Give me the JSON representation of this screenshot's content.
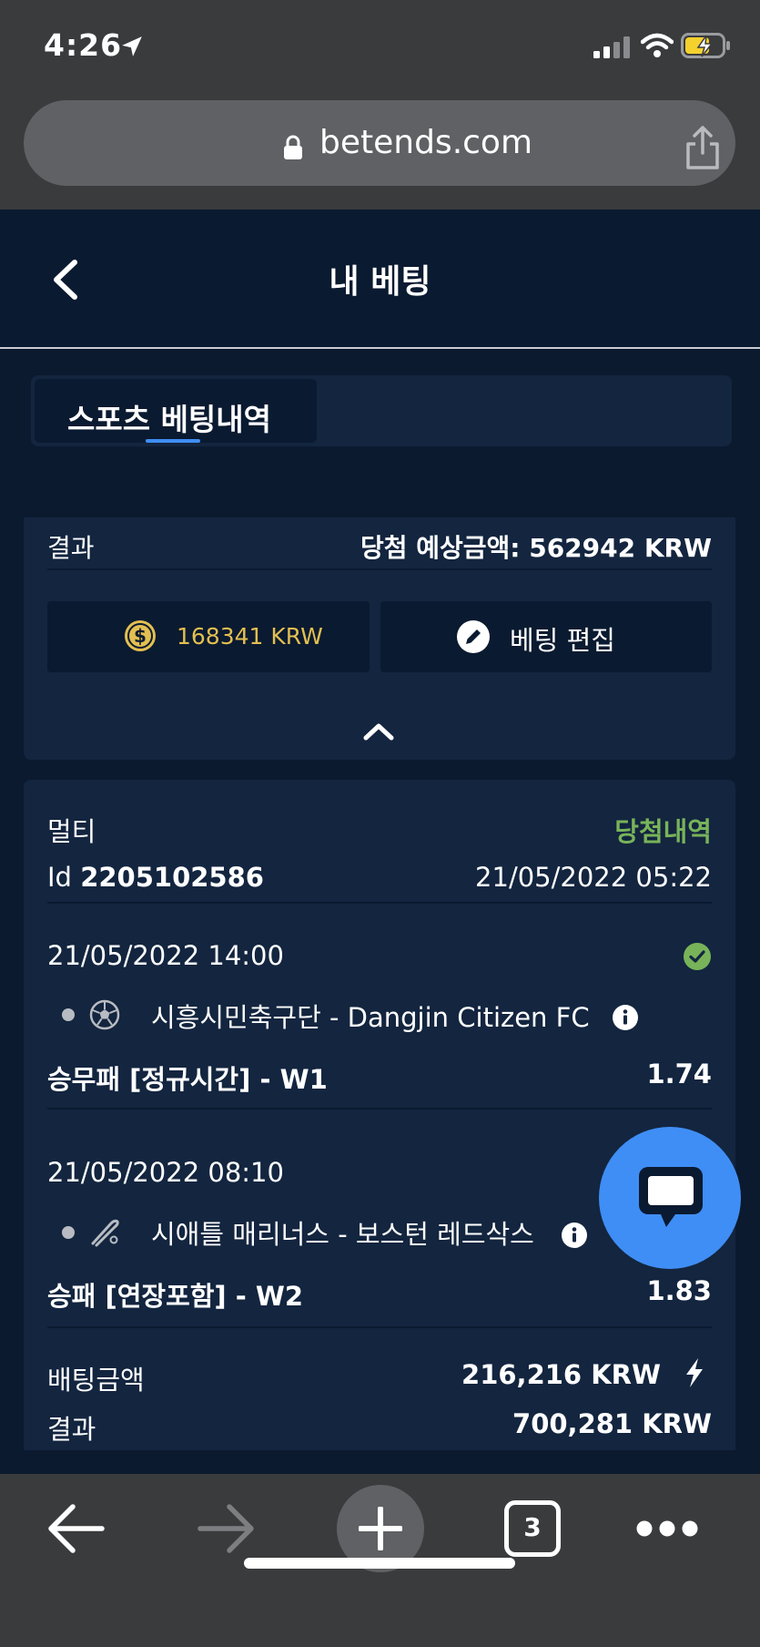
{
  "status_bar": {
    "time": "4:26"
  },
  "browser": {
    "url": "betends.com",
    "open_tabs": "3"
  },
  "header": {
    "title": "내 베팅"
  },
  "tabs": [
    {
      "label": "스포츠 베팅내역",
      "active": true
    }
  ],
  "summary_card": {
    "result_label": "결과",
    "potential_win": "당첨 예상금액: 562942 KRW",
    "stake": "168341  KRW",
    "edit_label": "베팅 편집"
  },
  "bet_card": {
    "type": "멀티",
    "status": "당첨내역",
    "id_prefix": "Id",
    "id": "2205102586",
    "placed_at": "21/05/2022 05:22",
    "events": [
      {
        "time": "21/05/2022 14:00",
        "sport": "soccer-ball-icon",
        "name": "시흥시민축구단 - Dangjin Citizen FC",
        "market": "승무패 [정규시간] - W1",
        "odds": "1.74"
      },
      {
        "time": "21/05/2022 08:10",
        "sport": "baseball-bat-icon",
        "name": "시애틀 매리너스 - 보스턴 레드삭스",
        "market": "승패 [연장포함] - W2",
        "odds": "1.83"
      }
    ],
    "stake_label": "배팅금액",
    "stake_value": "216,216 KRW",
    "result_label": "결과",
    "result_value": "700,281 KRW"
  },
  "colors": {
    "accent": "#3f8ef5",
    "win": "#78b35a",
    "coin": "#e3bf51",
    "background": "#0b1a2f",
    "card": "#13253f"
  }
}
